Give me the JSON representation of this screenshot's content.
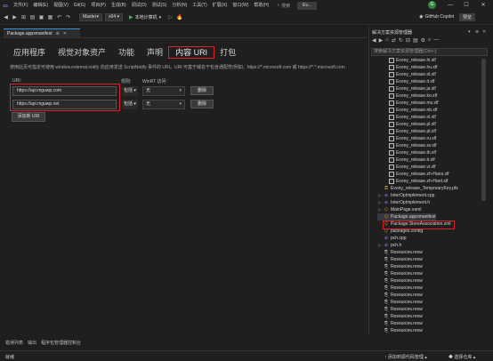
{
  "titlebar": {
    "menu": [
      "文件(F)",
      "编辑(E)",
      "视图(V)",
      "Git(G)",
      "项目(P)",
      "生成(B)",
      "调试(D)",
      "测试(S)",
      "分析(N)",
      "工具(T)",
      "扩展(X)",
      "窗口(W)",
      "帮助(H)"
    ],
    "search": "搜索",
    "solution_badge": "Ev...",
    "profile_initial": "G",
    "minimize": "—",
    "maximize": "☐",
    "close": "✕"
  },
  "toolbar": {
    "config": "Master",
    "platform": "x64",
    "run_label": "本地计算机",
    "copilot": "GitHub Copilot",
    "preview": "预览"
  },
  "doc_tab": {
    "title": "Package.appxmanifest",
    "pin": "⊕",
    "close": "✕"
  },
  "manifest": {
    "tabs": [
      {
        "label": "应用程序"
      },
      {
        "label": "视觉对象资产"
      },
      {
        "label": "功能"
      },
      {
        "label": "声明"
      },
      {
        "label": "内容 URI"
      },
      {
        "label": "打包"
      }
    ],
    "active_tab_index": 4,
    "description": "使用此页可指定可使用 window.external.notify 向应用发送 ScriptNotify 事件的 URI。URI 可基于域名干包含通配符(例如，https://*.microsoft.com 或 https://*.*.microsoft.com",
    "col_uri": "URI:",
    "col_rule": "规则:",
    "col_api": "WinRT 访问:",
    "rows": [
      {
        "uri": "https://api.mguwp.com",
        "rule": "包括",
        "api": "无",
        "delete": "删除"
      },
      {
        "uri": "https://api.mguwp.net",
        "rule": "包括",
        "api": "无",
        "delete": "删除"
      }
    ],
    "add_button": "添加新 URI"
  },
  "bottom_tabs": [
    "错误列表",
    "输出",
    "程序包管理器控制台"
  ],
  "statusbar": {
    "ready": "就绪",
    "source_control": "添加到源代码管理",
    "repo": "选择仓库"
  },
  "solution_explorer": {
    "title": "解决方案资源管理器",
    "search_placeholder": "搜索解决方案资源管理器(Ctrl+;)",
    "items": [
      {
        "label": "Evony_release.hi.xlf",
        "icon": "file",
        "indent": 2
      },
      {
        "label": "Evony_release.hu.xlf",
        "icon": "file",
        "indent": 2
      },
      {
        "label": "Evony_release.id.xlf",
        "icon": "file",
        "indent": 2
      },
      {
        "label": "Evony_release.it.xlf",
        "icon": "file",
        "indent": 2
      },
      {
        "label": "Evony_release.ja.xlf",
        "icon": "file",
        "indent": 2
      },
      {
        "label": "Evony_release.ko.xlf",
        "icon": "file",
        "indent": 2
      },
      {
        "label": "Evony_release.ms.xlf",
        "icon": "file",
        "indent": 2
      },
      {
        "label": "Evony_release.nb.xlf",
        "icon": "file",
        "indent": 2
      },
      {
        "label": "Evony_release.nl.xlf",
        "icon": "file",
        "indent": 2
      },
      {
        "label": "Evony_release.pl.xlf",
        "icon": "file",
        "indent": 2
      },
      {
        "label": "Evony_release.pt.xlf",
        "icon": "file",
        "indent": 2
      },
      {
        "label": "Evony_release.ru.xlf",
        "icon": "file",
        "indent": 2
      },
      {
        "label": "Evony_release.sv.xlf",
        "icon": "file",
        "indent": 2
      },
      {
        "label": "Evony_release.th.xlf",
        "icon": "file",
        "indent": 2
      },
      {
        "label": "Evony_release.tr.xlf",
        "icon": "file",
        "indent": 2
      },
      {
        "label": "Evony_release.vi.xlf",
        "icon": "file",
        "indent": 2
      },
      {
        "label": "Evony_release.zh-Hans.xlf",
        "icon": "file",
        "indent": 2
      },
      {
        "label": "Evony_release.zh-Hant.xlf",
        "icon": "file",
        "indent": 2
      },
      {
        "label": "Evony_release_TemporaryKey.pfx",
        "icon": "pfx",
        "indent": 1
      },
      {
        "label": "InterOpImplement.cpp",
        "icon": "cpp",
        "indent": 1,
        "expander": "▷"
      },
      {
        "label": "InterOpImplement.h",
        "icon": "cpp",
        "indent": 1,
        "expander": "▷"
      },
      {
        "label": "MainPage.xaml",
        "icon": "xml",
        "indent": 1,
        "expander": "▷"
      },
      {
        "label": "Package.appxmanifest",
        "icon": "xml",
        "indent": 1,
        "selected": true
      },
      {
        "label": "Package.StoreAssociation.xml",
        "icon": "xml",
        "indent": 1
      },
      {
        "label": "packages.config",
        "icon": "xml",
        "indent": 1
      },
      {
        "label": "pch.cpp",
        "icon": "cpp",
        "indent": 1
      },
      {
        "label": "pch.h",
        "icon": "cpp",
        "indent": 1,
        "expander": "▷"
      },
      {
        "label": "Resources.resw",
        "icon": "res",
        "indent": 1
      },
      {
        "label": "Resources.resw",
        "icon": "res",
        "indent": 1
      },
      {
        "label": "Resources.resw",
        "icon": "res",
        "indent": 1
      },
      {
        "label": "Resources.resw",
        "icon": "res",
        "indent": 1
      },
      {
        "label": "Resources.resw",
        "icon": "res",
        "indent": 1
      },
      {
        "label": "Resources.resw",
        "icon": "res",
        "indent": 1
      },
      {
        "label": "Resources.resw",
        "icon": "res",
        "indent": 1
      },
      {
        "label": "Resources.resw",
        "icon": "res",
        "indent": 1
      },
      {
        "label": "Resources.resw",
        "icon": "res",
        "indent": 1
      },
      {
        "label": "Resources.resw",
        "icon": "res",
        "indent": 1
      },
      {
        "label": "Resources.resw",
        "icon": "res",
        "indent": 1
      },
      {
        "label": "Resources.resw",
        "icon": "res",
        "indent": 1
      }
    ]
  },
  "colors": {
    "accent_purple": "#b180d7",
    "highlight_red": "#e0202a",
    "run_green": "#3fb950"
  }
}
